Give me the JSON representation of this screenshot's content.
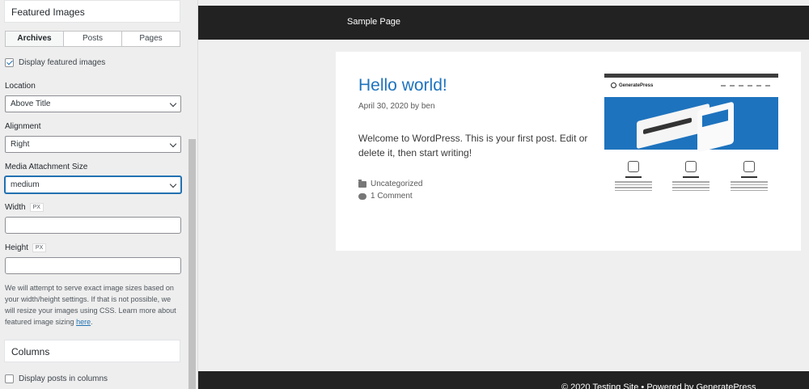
{
  "sidebar": {
    "section_title": "Featured Images",
    "tabs": [
      {
        "label": "Archives",
        "active": true
      },
      {
        "label": "Posts",
        "active": false
      },
      {
        "label": "Pages",
        "active": false
      }
    ],
    "display_featured": {
      "label": "Display featured images",
      "checked": true
    },
    "location": {
      "label": "Location",
      "value": "Above Title"
    },
    "alignment": {
      "label": "Alignment",
      "value": "Right"
    },
    "media_size": {
      "label": "Media Attachment Size",
      "value": "medium"
    },
    "width": {
      "label": "Width",
      "unit": "PX",
      "value": ""
    },
    "height": {
      "label": "Height",
      "unit": "PX",
      "value": ""
    },
    "help_text": "We will attempt to serve exact image sizes based on your width/height settings. If that is not possible, we will resize your images using CSS. Learn more about featured image sizing",
    "help_link": "here",
    "help_end": ".",
    "columns_section": "Columns",
    "display_columns": {
      "label": "Display posts in columns",
      "checked": false
    }
  },
  "preview": {
    "nav_link": "Sample Page",
    "post": {
      "title": "Hello world!",
      "meta": "April 30, 2020 by ben",
      "excerpt": "Welcome to WordPress. This is your first post. Edit or delete it, then start writing!",
      "category": "Uncategorized",
      "comments": "1 Comment"
    },
    "featured_image": {
      "brand": "GeneratePress"
    },
    "footer": "© 2020 Testing Site • Powered by GeneratePress"
  },
  "colors": {
    "accent": "#2271b1",
    "link_blue": "#1e73be",
    "header_bg": "#222222"
  }
}
